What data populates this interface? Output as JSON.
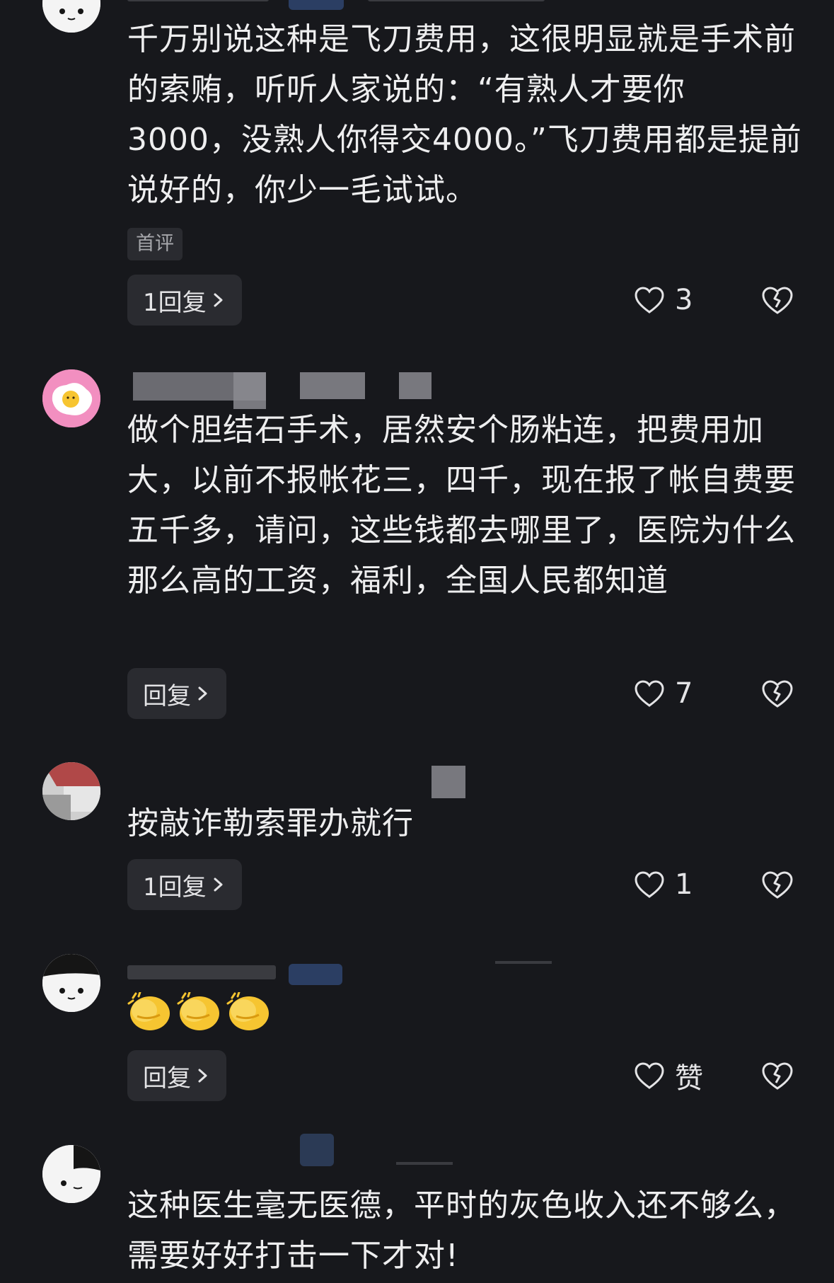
{
  "comments": [
    {
      "text": "千万别说这种是飞刀费用，这很明显就是手术前的索贿，听听人家说的：“有熟人才要你 3000，没熟人你得交4000。”飞刀费用都是提前说好的，你少一毛试试。",
      "badge": "首评",
      "reply_label": "1回复",
      "like_count": "3"
    },
    {
      "text": "做个胆结石手术，居然安个肠粘连，把费用加大，以前不报帐花三，四千，现在报了帐自费要五千多，请问，这些钱都去哪里了，医院为什么那么高的工资，福利，全国人民都知道",
      "reply_label": "回复",
      "like_count": "7"
    },
    {
      "text": "按敲诈勒索罪办就行",
      "reply_label": "1回复",
      "like_count": "1"
    },
    {
      "text": "",
      "emoji_names": [
        "clapping-hands-icon",
        "clapping-hands-icon",
        "clapping-hands-icon"
      ],
      "reply_label": "回复",
      "like_count": "赞"
    },
    {
      "text": "这种医生毫无医德，平时的灰色收入还不够么，需要好好打击一下才对!"
    }
  ],
  "icons": {
    "like": "heart-outline-icon",
    "dislike": "broken-heart-icon",
    "reply_arrow": "chevron-right-icon"
  },
  "colors": {
    "background": "#17181c",
    "text": "#eeeeef",
    "button_bg": "#2a2b30",
    "secondary_text": "#a6a7ab"
  }
}
